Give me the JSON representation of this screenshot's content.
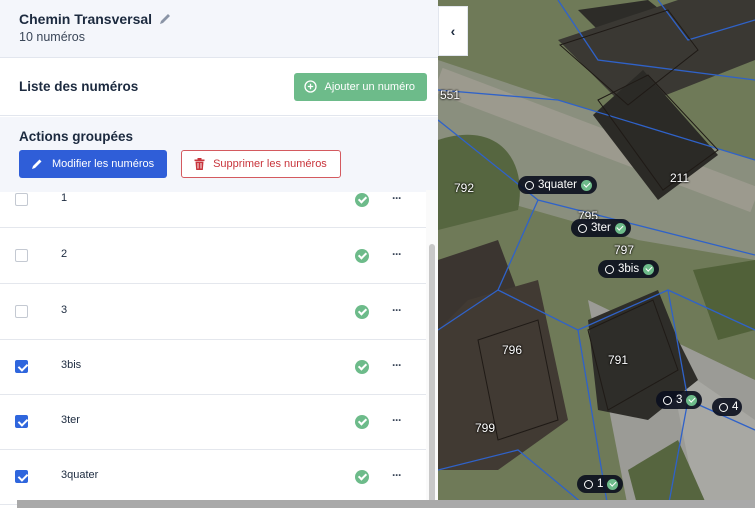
{
  "street": {
    "name": "Chemin Transversal",
    "count_label": "10 numéros",
    "edit_icon": "pencil-icon"
  },
  "list": {
    "title": "Liste des numéros",
    "add_button": "Ajouter un numéro",
    "add_icon": "plus-circle-icon"
  },
  "bulk_actions": {
    "title": "Actions groupées",
    "modify_button": "Modifier les numéros",
    "delete_button": "Supprimer les numéros",
    "modify_icon": "pencil-icon",
    "delete_icon": "trash-icon"
  },
  "rows": [
    {
      "number": "1",
      "checked": false,
      "status": "valid",
      "more": "···"
    },
    {
      "number": "2",
      "checked": false,
      "status": "valid",
      "more": "···"
    },
    {
      "number": "3",
      "checked": false,
      "status": "valid",
      "more": "···"
    },
    {
      "number": "3bis",
      "checked": true,
      "status": "valid",
      "more": "···"
    },
    {
      "number": "3ter",
      "checked": true,
      "status": "valid",
      "more": "···"
    },
    {
      "number": "3quater",
      "checked": true,
      "status": "valid",
      "more": "···"
    }
  ],
  "map": {
    "collapse_icon": "chevron-left-icon",
    "collapse_glyph": "‹",
    "parcels": [
      "551",
      "792",
      "211",
      "795",
      "797",
      "796",
      "791",
      "799"
    ],
    "pins": [
      "3quater",
      "3ter",
      "3bis",
      "3",
      "4",
      "1"
    ]
  },
  "colors": {
    "primary": "#2f5ed8",
    "success": "#6dbb8a",
    "danger": "#c8343b"
  }
}
